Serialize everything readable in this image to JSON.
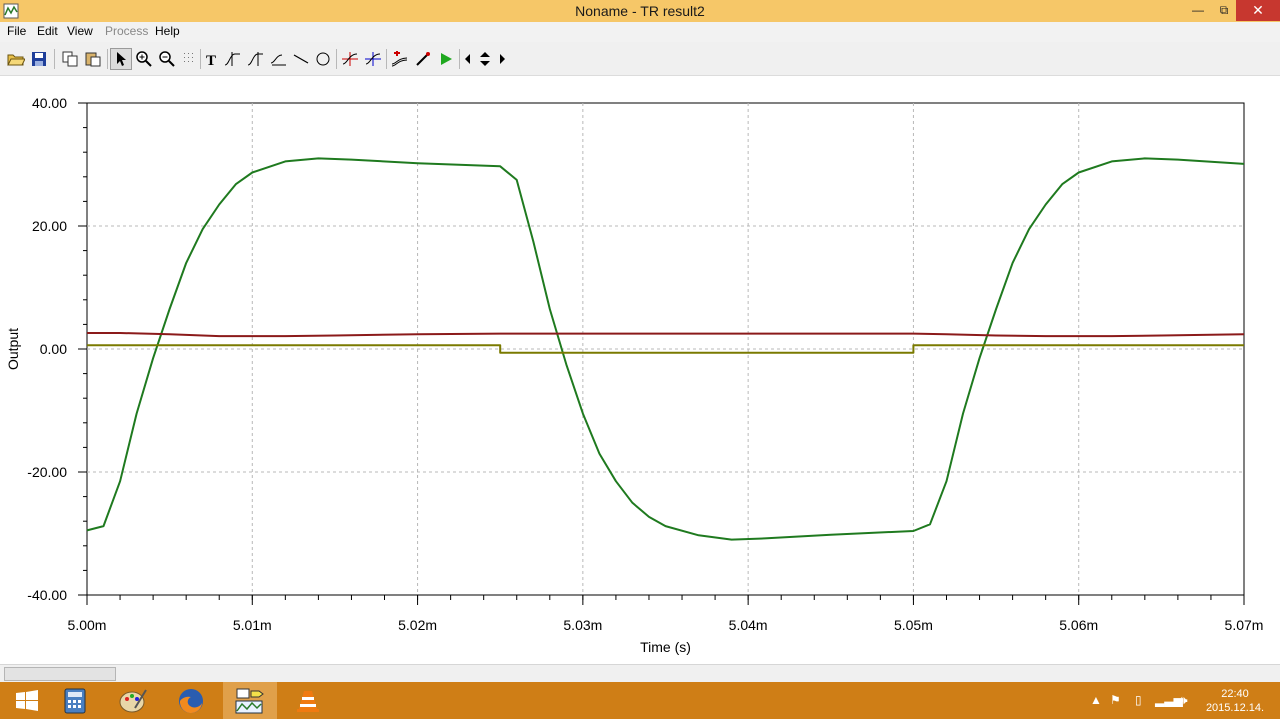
{
  "window": {
    "title": "Noname - TR result2",
    "minimize_glyph": "—",
    "maximize_glyph": "⧉",
    "close_glyph": "✕"
  },
  "menu": {
    "items": [
      {
        "label": "File",
        "enabled": true
      },
      {
        "label": "Edit",
        "enabled": true
      },
      {
        "label": "View",
        "enabled": true
      },
      {
        "label": "Process",
        "enabled": false
      },
      {
        "label": "Help",
        "enabled": true
      }
    ]
  },
  "toolbar": {
    "tools": [
      "open-icon",
      "save-icon",
      "copy-icon",
      "paste-icon",
      "select-arrow-icon",
      "zoom-in-icon",
      "zoom-100-icon",
      "grid-icon",
      "text-tool-icon",
      "cursor-a-icon",
      "cursor-b-icon",
      "arrow-tool-icon",
      "line-tool-icon",
      "circle-tool-icon",
      "crosshair-icon",
      "crosshair-b-icon",
      "add-trace-icon",
      "probe-icon",
      "run-icon",
      "scroll-left-icon",
      "scroll-up-down-icon",
      "scroll-right-icon"
    ],
    "active": "select-arrow-icon"
  },
  "chart_data": {
    "type": "line",
    "xlabel": "Time (s)",
    "ylabel": "Output",
    "xlim": [
      5.0,
      5.07
    ],
    "ylim": [
      -40,
      40
    ],
    "x_ticks": [
      5.0,
      5.01,
      5.02,
      5.03,
      5.04,
      5.05,
      5.06,
      5.07
    ],
    "x_tick_labels": [
      "5.00m",
      "5.01m",
      "5.02m",
      "5.03m",
      "5.04m",
      "5.05m",
      "5.06m",
      "5.07m"
    ],
    "y_ticks": [
      -40,
      -20,
      0,
      20,
      40
    ],
    "y_tick_labels": [
      "-40.00",
      "-20.00",
      "0.00",
      "20.00",
      "40.00"
    ],
    "grid": true,
    "series": [
      {
        "color": "#1f7a1f",
        "x": [
          5.0,
          5.001,
          5.002,
          5.003,
          5.004,
          5.005,
          5.006,
          5.007,
          5.008,
          5.009,
          5.01,
          5.012,
          5.014,
          5.016,
          5.02,
          5.025,
          5.026,
          5.027,
          5.028,
          5.029,
          5.03,
          5.031,
          5.032,
          5.033,
          5.034,
          5.035,
          5.037,
          5.039,
          5.041,
          5.045,
          5.05,
          5.051,
          5.052,
          5.053,
          5.054,
          5.055,
          5.056,
          5.057,
          5.058,
          5.059,
          5.06,
          5.062,
          5.064,
          5.066,
          5.07
        ],
        "y": [
          -29.5,
          -28.8,
          -21.5,
          -10.5,
          -1.5,
          6.5,
          14.0,
          19.5,
          23.5,
          26.8,
          28.7,
          30.5,
          31.0,
          30.8,
          30.2,
          29.7,
          27.5,
          17.5,
          6.5,
          -2.5,
          -10.5,
          -17.0,
          -21.5,
          -25.0,
          -27.3,
          -28.8,
          -30.3,
          -31.0,
          -30.8,
          -30.2,
          -29.6,
          -28.5,
          -21.5,
          -10.5,
          -1.5,
          6.5,
          14.0,
          19.5,
          23.5,
          26.8,
          28.7,
          30.5,
          31.0,
          30.8,
          30.1
        ]
      },
      {
        "color": "#8b1a1a",
        "x": [
          5.0,
          5.002,
          5.005,
          5.008,
          5.012,
          5.015,
          5.02,
          5.025,
          5.03,
          5.04,
          5.05,
          5.052,
          5.055,
          5.058,
          5.062,
          5.065,
          5.07
        ],
        "y": [
          2.6,
          2.6,
          2.4,
          2.1,
          2.1,
          2.2,
          2.4,
          2.5,
          2.5,
          2.5,
          2.5,
          2.4,
          2.2,
          2.1,
          2.1,
          2.2,
          2.4
        ]
      },
      {
        "color": "#7a7a00",
        "x": [
          5.0,
          5.025,
          5.025,
          5.05,
          5.05,
          5.07
        ],
        "y": [
          0.6,
          0.6,
          -0.6,
          -0.6,
          0.6,
          0.6
        ]
      }
    ]
  },
  "taskbar": {
    "apps": [
      "windows-start-icon",
      "calculator-icon",
      "paint-icon",
      "firefox-icon",
      "tina-icon",
      "vlc-icon"
    ],
    "active_app": "tina-icon",
    "clock_time": "22:40",
    "clock_date": "2015.12.14."
  }
}
